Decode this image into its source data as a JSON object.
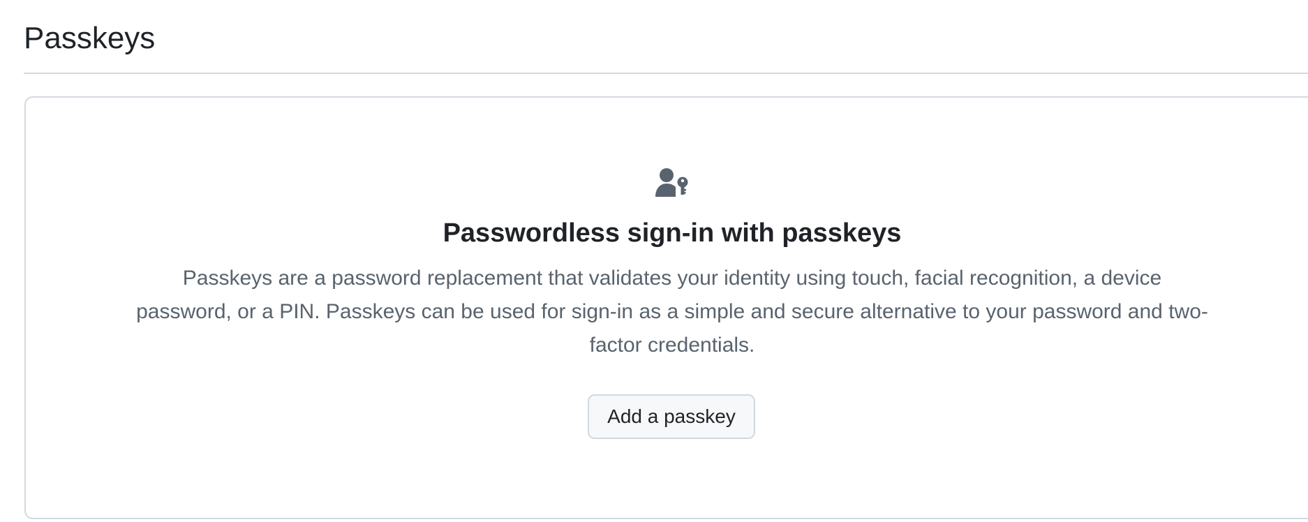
{
  "page": {
    "title": "Passkeys"
  },
  "blankslate": {
    "icon": "passkey-icon",
    "heading": "Passwordless sign-in with passkeys",
    "description_lines": [
      "Passkeys are a password replacement that validates your identity using touch, facial recognition, a device",
      "password, or a PIN. Passkeys can be used for sign-in as a simple and secure alternative to your password and two-",
      "factor credentials."
    ],
    "add_button_label": "Add a passkey"
  },
  "colors": {
    "text_primary": "#1f2328",
    "text_muted": "#59636e",
    "border": "#d1d9e0",
    "icon": "#59636e",
    "button_bg": "#f6f8fa"
  }
}
